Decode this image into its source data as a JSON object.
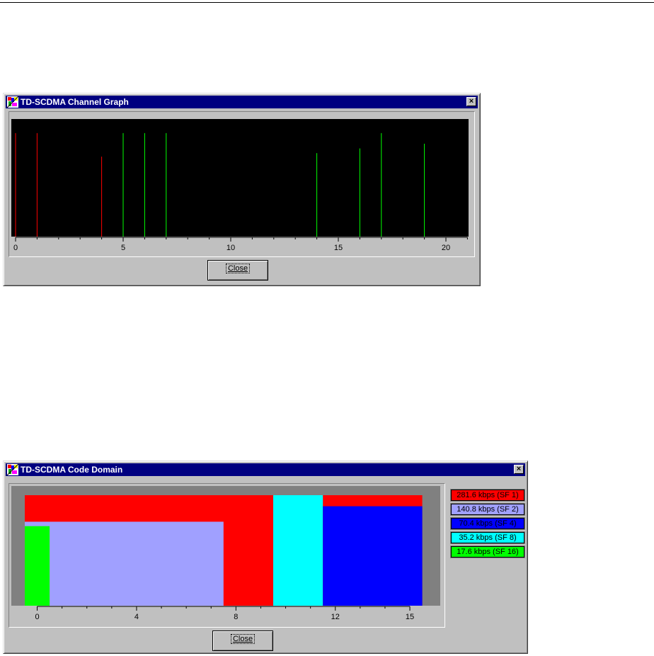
{
  "channel_window": {
    "title": "TD-SCDMA Channel Graph",
    "close_label": "Close",
    "close_icon": "×",
    "chart_data": {
      "type": "bar",
      "xlim": [
        0,
        21
      ],
      "x_ticks": [
        "0",
        "5",
        "10",
        "15",
        "20"
      ],
      "series": [
        {
          "color": "#ff0000",
          "x": [
            0,
            1,
            4
          ],
          "y": [
            0.88,
            0.88,
            0.68
          ]
        },
        {
          "color": "#00ff00",
          "x": [
            5,
            6,
            7,
            14,
            16,
            17,
            19
          ],
          "y": [
            0.88,
            0.88,
            0.88,
            0.71,
            0.75,
            0.88,
            0.79
          ]
        }
      ]
    }
  },
  "code_window": {
    "title": "TD-SCDMA Code Domain",
    "close_label": "Close",
    "close_icon": "×",
    "legend": [
      {
        "label": "281.6 kbps (SF 1)",
        "color": "#ff0000"
      },
      {
        "label": "140.8 kbps (SF 2)",
        "color": "#a0a0ff"
      },
      {
        "label": "70.4 kbps (SF 4)",
        "color": "#0000ff"
      },
      {
        "label": "35.2 kbps (SF 8)",
        "color": "#00ffff"
      },
      {
        "label": "17.6 kbps (SF 16)",
        "color": "#00ff00"
      }
    ],
    "chart_data": {
      "type": "area",
      "x_ticks": [
        "0",
        "4",
        "8",
        "12",
        "15"
      ],
      "blocks": [
        {
          "label": "281.6 kbps (SF 1)",
          "start": 0,
          "end": 16,
          "level": 1.0,
          "color": "#ff0000"
        },
        {
          "label": "140.8 kbps (SF 2)",
          "start": 0,
          "end": 8,
          "level": 0.76,
          "color": "#a0a0ff"
        },
        {
          "label": "17.6 kbps (SF 16)",
          "start": 0,
          "end": 1,
          "level": 0.72,
          "color": "#00ff00"
        },
        {
          "label": "35.2 kbps (SF 8)",
          "start": 10,
          "end": 12,
          "level": 1.0,
          "color": "#00ffff"
        },
        {
          "label": "70.4 kbps (SF 4)",
          "start": 12,
          "end": 16,
          "level": 0.9,
          "color": "#0000ff"
        }
      ]
    }
  }
}
